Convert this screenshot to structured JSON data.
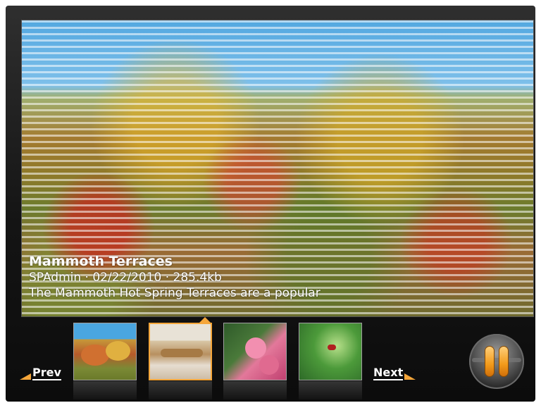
{
  "slide": {
    "title": "Mammoth Terraces",
    "meta": "SPAdmin · 02/22/2010 · 285.4kb",
    "description": "The Mammoth Hot Spring Terraces are a popular"
  },
  "nav": {
    "prev_label": "Prev",
    "next_label": "Next"
  },
  "thumbnails": [
    {
      "name": "autumn-trees",
      "active": false
    },
    {
      "name": "mammoth-terraces",
      "active": true
    },
    {
      "name": "pink-flowers",
      "active": false
    },
    {
      "name": "green-plants-bug",
      "active": false
    }
  ],
  "controls": {
    "pause_icon": "pause-icon"
  },
  "colors": {
    "accent": "#f5a63a",
    "background": "#141414"
  }
}
